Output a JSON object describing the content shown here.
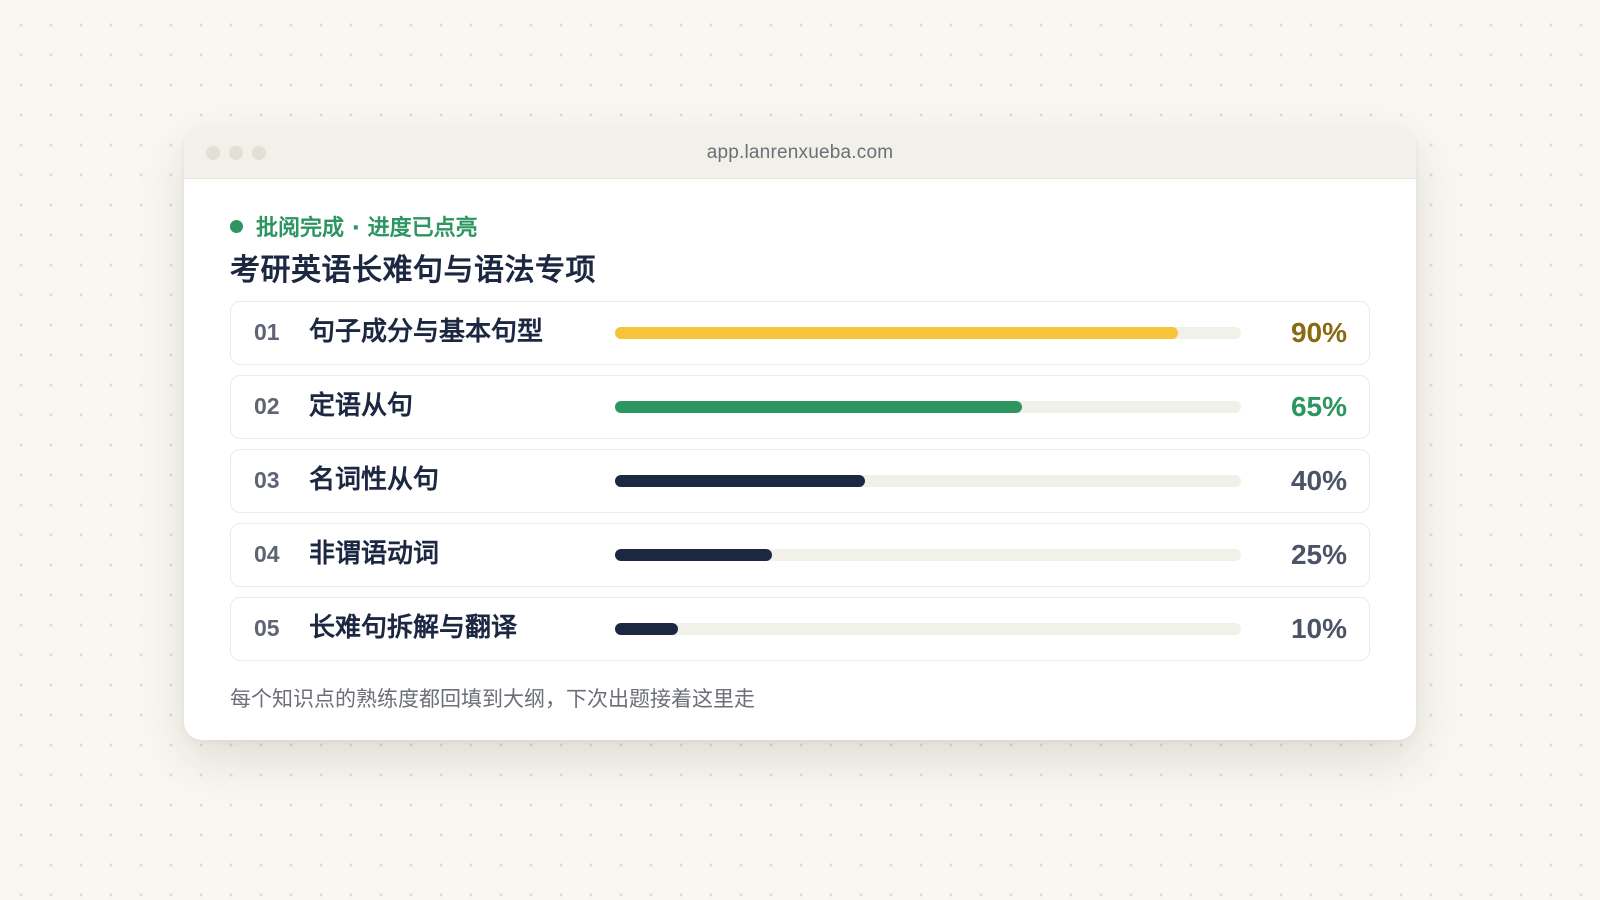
{
  "window": {
    "url": "app.lanrenxueba.com"
  },
  "status": {
    "text": "批阅完成 · 进度已点亮",
    "color": "#2d9560"
  },
  "page_title": "考研英语长难句与语法专项",
  "topics": [
    {
      "num": "01",
      "label": "句子成分与基本句型",
      "progress": 0.9,
      "percent_text": "90%",
      "bar_color": "#f7c33b",
      "text_color": "#8a6a10"
    },
    {
      "num": "02",
      "label": "定语从句",
      "progress": 0.65,
      "percent_text": "65%",
      "bar_color": "#2d9560",
      "text_color": "#2d9560"
    },
    {
      "num": "03",
      "label": "名词性从句",
      "progress": 0.4,
      "percent_text": "40%",
      "bar_color": "#1c2742",
      "text_color": "#4c5366"
    },
    {
      "num": "04",
      "label": "非谓语动词",
      "progress": 0.25,
      "percent_text": "25%",
      "bar_color": "#1c2742",
      "text_color": "#4c5366"
    },
    {
      "num": "05",
      "label": "长难句拆解与翻译",
      "progress": 0.1,
      "percent_text": "10%",
      "bar_color": "#1c2742",
      "text_color": "#4c5366"
    }
  ],
  "footnote": "每个知识点的熟练度都回填到大纲，下次出题接着这里走",
  "icons": {
    "status_indicator": "status-dot-icon",
    "window_controls": "window-dot-icon"
  }
}
